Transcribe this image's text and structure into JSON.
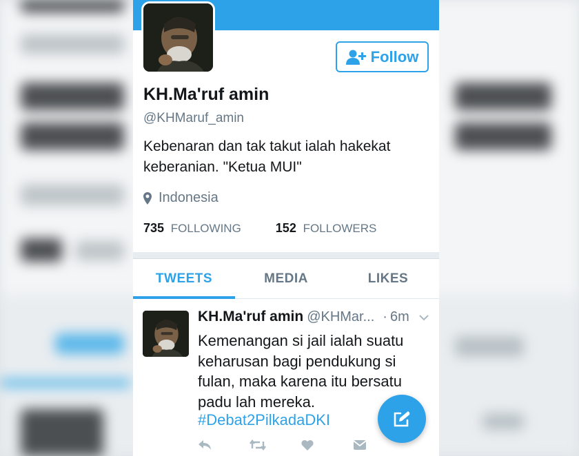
{
  "profile": {
    "name": "KH.Ma'ruf amin",
    "handle": "@KHMaruf_amin",
    "bio": "Kebenaran dan tak takut ialah hakekat keberanian. \"Ketua MUI\"",
    "location": "Indonesia",
    "following_count": "735",
    "following_label": "FOLLOWING",
    "followers_count": "152",
    "followers_label": "FOLLOWERS",
    "follow_label": "Follow"
  },
  "tabs": [
    {
      "label": "TWEETS",
      "active": true
    },
    {
      "label": "MEDIA",
      "active": false
    },
    {
      "label": "LIKES",
      "active": false
    }
  ],
  "tweet": {
    "name": "KH.Ma'ruf amin",
    "handle": "@KHMar...",
    "dot": "·",
    "time": "6m",
    "text": "Kemenangan si jail ialah suatu keharusan bagi pendukung si fulan, maka karena itu bersatu padu lah mereka.",
    "hashtag": "#Debat2PilkadaDKI"
  },
  "icons": {
    "follow": "add-user-icon",
    "location": "map-pin-icon",
    "reply": "reply-icon",
    "retweet": "retweet-icon",
    "like": "heart-icon",
    "dm": "message-icon",
    "compose": "compose-icon",
    "caret": "chevron-down-icon"
  },
  "colors": {
    "accent": "#2ea2e8",
    "text": "#14171a",
    "muted": "#657786"
  }
}
